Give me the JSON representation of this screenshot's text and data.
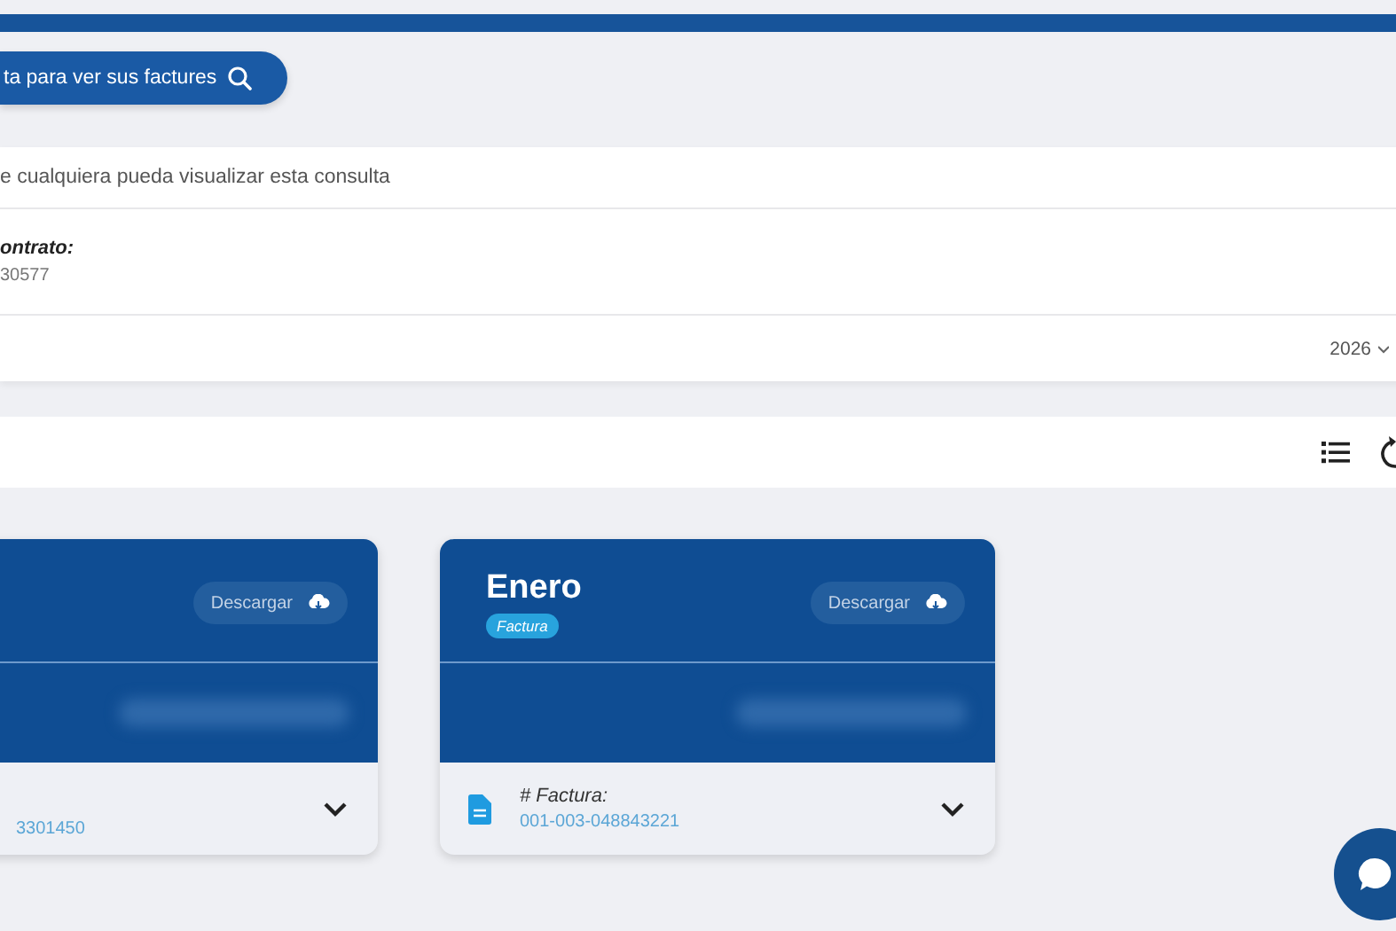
{
  "search_button": {
    "label": "ta para ver sus factures"
  },
  "notice": "e cualquiera pueda visualizar esta consulta",
  "contract": {
    "label": "ontrato:",
    "value": "30577"
  },
  "year_select": {
    "value": "2026"
  },
  "invoices": [
    {
      "download_label": "Descargar",
      "number": "3301450",
      "expanded": false
    },
    {
      "title": "Enero",
      "tag": "Factura",
      "download_label": "Descargar",
      "number_label": "# Factura:",
      "number": "001-003-048843221",
      "expanded": false
    }
  ]
}
